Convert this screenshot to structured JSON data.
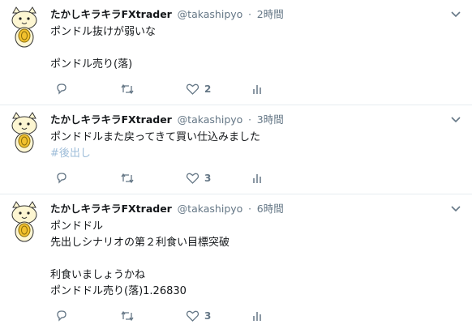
{
  "tweets": [
    {
      "user": {
        "name": "たかしキラキラFXtrader",
        "handle": "@takashipyo"
      },
      "separator": "·",
      "time": "2時間",
      "lines": [
        "ポンドル抜けが弱いな",
        "",
        "ポンドル売り(落)"
      ],
      "hashtag": "",
      "likes": "2",
      "icons": {
        "reply": "reply-icon",
        "retweet": "retweet-icon",
        "like": "heart-icon",
        "analytics": "analytics-icon",
        "menu": "chevron-down-icon"
      }
    },
    {
      "user": {
        "name": "たかしキラキラFXtrader",
        "handle": "@takashipyo"
      },
      "separator": "·",
      "time": "3時間",
      "lines": [
        "ポンドドルまた戻ってきて買い仕込みました"
      ],
      "hashtag": "#後出し",
      "likes": "3",
      "icons": {
        "reply": "reply-icon",
        "retweet": "retweet-icon",
        "like": "heart-icon",
        "analytics": "analytics-icon",
        "menu": "chevron-down-icon"
      }
    },
    {
      "user": {
        "name": "たかしキラキラFXtrader",
        "handle": "@takashipyo"
      },
      "separator": "·",
      "time": "6時間",
      "lines": [
        "ポンドドル",
        "先出しシナリオの第２利食い目標突破",
        "",
        "利食いましょうかね",
        "ポンドドル売り(落)1.26830"
      ],
      "hashtag": "",
      "likes": "3",
      "icons": {
        "reply": "reply-icon",
        "retweet": "retweet-icon",
        "like": "heart-icon",
        "analytics": "analytics-icon",
        "menu": "chevron-down-icon"
      }
    }
  ],
  "colors": {
    "text": "#14171a",
    "muted": "#657786",
    "hashtag": "#9ebdd9",
    "divider": "#e6ecf0",
    "avatar_cat": "#fdf6d2",
    "avatar_coin": "#f2c12e"
  }
}
